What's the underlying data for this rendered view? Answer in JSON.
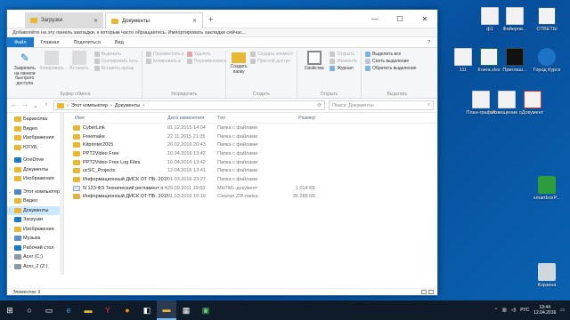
{
  "browser": {
    "tabs": [
      {
        "label": "Загрузки",
        "active": false
      },
      {
        "label": "Документы",
        "active": true
      }
    ],
    "bookmark_hint": "Добавляйте на эту панель закладки, к которым часто обращаетесь. Импортировать закладки сейчас..."
  },
  "ribbon": {
    "tabs": [
      "Файл",
      "Главная",
      "Поделиться",
      "Вид"
    ],
    "groups": [
      {
        "name": "Буфер обмена",
        "buttons": [
          "Закрепить на панели быстрого доступа",
          "Копировать",
          "Вставить"
        ],
        "small": [
          "Вырезать",
          "Скопировать путь",
          "Вставить ярлык"
        ]
      },
      {
        "name": "Упорядочить",
        "buttons": [],
        "small": [
          "Переместить в",
          "Копировать в",
          "Удалить",
          "Переименовать"
        ]
      },
      {
        "name": "Создать",
        "buttons": [
          "Создать папку"
        ],
        "small": [
          "Создать элемент",
          "Простой доступ"
        ]
      },
      {
        "name": "Открыть",
        "buttons": [
          "Свойства"
        ],
        "small": [
          "Открыть",
          "Изменить",
          "Журнал"
        ]
      },
      {
        "name": "Выделить",
        "buttons": [],
        "small": [
          "Выделить все",
          "Снять выделение",
          "Обратить выделение"
        ]
      }
    ]
  },
  "address": {
    "path": [
      "Этот компьютер",
      "Документы"
    ],
    "search_placeholder": "Поиск: Документы"
  },
  "nav": [
    {
      "label": "Барахолка",
      "icon": "folder",
      "chev": ""
    },
    {
      "label": "Видео",
      "icon": "folder",
      "chev": ""
    },
    {
      "label": "Изображения",
      "icon": "folder",
      "chev": ""
    },
    {
      "label": "ЮТУБ",
      "icon": "folder",
      "chev": ""
    },
    {
      "label": "OneDrive",
      "icon": "cloud",
      "chev": "›",
      "gap": true
    },
    {
      "label": "Документы",
      "icon": "folder",
      "chev": "›"
    },
    {
      "label": "Изображения",
      "icon": "folder",
      "chev": "›"
    },
    {
      "label": "Этот компьютер",
      "icon": "pc",
      "chev": "⌄",
      "gap": true
    },
    {
      "label": "Видео",
      "icon": "folder",
      "chev": "›"
    },
    {
      "label": "Документы",
      "icon": "folder",
      "chev": "›",
      "selected": true
    },
    {
      "label": "Загрузки",
      "icon": "download",
      "chev": "›"
    },
    {
      "label": "Изображения",
      "icon": "folder",
      "chev": "›"
    },
    {
      "label": "Музыка",
      "icon": "music",
      "chev": "›"
    },
    {
      "label": "Рабочий стол",
      "icon": "desktop",
      "chev": "›"
    },
    {
      "label": "Acer (C:)",
      "icon": "drive",
      "chev": "›"
    },
    {
      "label": "Acer_2 (Z:)",
      "icon": "drive",
      "chev": "›"
    },
    {
      "label": "Сеть",
      "icon": "network",
      "chev": "⌄",
      "gap": true
    },
    {
      "label": "ACER",
      "icon": "pc",
      "chev": "›"
    }
  ],
  "columns": {
    "name": "Имя",
    "date": "Дата изменения",
    "type": "Тип",
    "size": "Размер"
  },
  "files": [
    {
      "name": "CyberLink",
      "date": "01.12.2015 14:04",
      "type": "Папка с файлами",
      "size": "",
      "icon": "folder"
    },
    {
      "name": "Freemake",
      "date": "22.11.2015 21:35",
      "type": "Папка с файлами",
      "size": "",
      "icon": "folder"
    },
    {
      "name": "Kitprinter2015",
      "date": "26.02.2016 20:43",
      "type": "Папка с файлами",
      "size": "",
      "icon": "folder"
    },
    {
      "name": "PPT2Video Free",
      "date": "10.04.2016 13:42",
      "type": "Папка с файлами",
      "size": "",
      "icon": "folder"
    },
    {
      "name": "PPT2Video Free Log Files",
      "date": "10.04.2016 13:42",
      "type": "Папка с файлами",
      "size": "",
      "icon": "folder"
    },
    {
      "name": "ucSC_Projects",
      "date": "12.04.2016 13:41",
      "type": "Папка с файлами",
      "size": "",
      "icon": "folder"
    },
    {
      "name": "Информационный ДИСК ОТ ПБ. 2015",
      "date": "01.03.2016 23:27",
      "type": "Папка с файлами",
      "size": "",
      "icon": "folder"
    },
    {
      "name": "N 123-ФЗ Технический регламент о тре...",
      "date": "29.09.2011 19:50",
      "type": "MHTML-документ",
      "size": "1 014 КБ",
      "icon": "doc"
    },
    {
      "name": "Информационный ДИСК ОТ ПБ. 2015",
      "date": "01.03.2016 10:10",
      "type": "Сжатая ZIP-папка",
      "size": "35 288 КБ",
      "icon": "zip"
    }
  ],
  "status": "Элементов: 9",
  "desktop_icons": [
    {
      "label": "ф1"
    },
    {
      "label": "Файеров..."
    },
    {
      "label": "ОТВЕТЫ"
    },
    {
      "label": "111"
    },
    {
      "label": "Книга.xlsx"
    },
    {
      "label": "Приглаш..."
    },
    {
      "label": "План-график"
    },
    {
      "label": "Извещение о"
    },
    {
      "label": "Документ"
    },
    {
      "label": "Город Курск"
    },
    {
      "label": "smartboxP..."
    },
    {
      "label": "Корзина"
    }
  ],
  "taskbar": {
    "lang": "РУС",
    "time": "13:44",
    "date": "12.04.2016"
  },
  "colors": {
    "accent": "#1979ca",
    "folder": "#e8b830",
    "selection": "#cce8ff"
  }
}
